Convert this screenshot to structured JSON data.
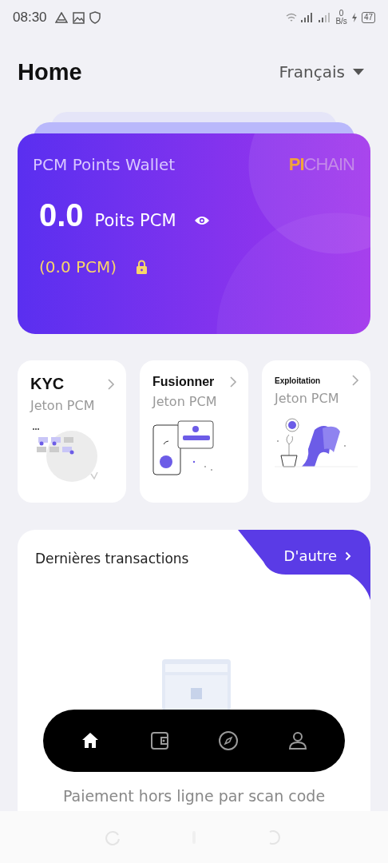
{
  "status_bar": {
    "time": "08:30",
    "speed_value": "0",
    "speed_unit": "B/s",
    "battery": "47"
  },
  "header": {
    "title": "Home",
    "language": "Français"
  },
  "wallet": {
    "title": "PCM Points Wallet",
    "logo": {
      "part_1": "PI",
      "part_2": "CHAIN"
    },
    "amount": "0.0",
    "unit": "Poits PCM",
    "locked": "(0.0 PCM)"
  },
  "features": [
    {
      "kind": "kyc",
      "title": "KYC",
      "subtitle": "Jeton PCM"
    },
    {
      "kind": "merge",
      "title": "Fusionner",
      "subtitle": "Jeton PCM"
    },
    {
      "kind": "mining",
      "title": "Exploitation",
      "subtitle": "Jeton PCM"
    }
  ],
  "transactions": {
    "title": "Dernières transactions",
    "more": "D'autre",
    "empty_text": "Paiement hors ligne par scan code"
  },
  "bottom_nav": [
    {
      "kind": "home",
      "selected": true
    },
    {
      "kind": "wallet",
      "selected": false
    },
    {
      "kind": "discover",
      "selected": false
    },
    {
      "kind": "profile",
      "selected": false
    }
  ]
}
